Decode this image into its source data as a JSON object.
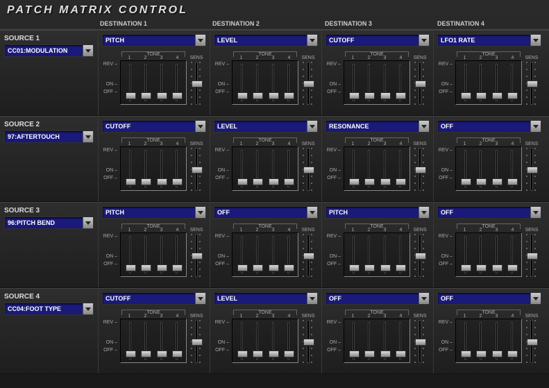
{
  "title": "PATCH MATRIX CONTROL",
  "dest_headers": [
    "DESTINATION 1",
    "DESTINATION 2",
    "DESTINATION 3",
    "DESTINATION 4"
  ],
  "tone_label": "TONE",
  "tone_nums": [
    "1",
    "2",
    "3",
    "4"
  ],
  "sens_label": "SENS",
  "sw": {
    "rev": "REV",
    "on": "ON",
    "off": "OFF"
  },
  "rows": [
    {
      "label": "SOURCE 1",
      "source": "CC01:MODULATION",
      "cells": [
        {
          "dest": "PITCH"
        },
        {
          "dest": "LEVEL"
        },
        {
          "dest": "CUTOFF"
        },
        {
          "dest": "LFO1 RATE"
        }
      ]
    },
    {
      "label": "SOURCE 2",
      "source": "97:AFTERTOUCH",
      "cells": [
        {
          "dest": "CUTOFF"
        },
        {
          "dest": "LEVEL"
        },
        {
          "dest": "RESONANCE"
        },
        {
          "dest": "OFF"
        }
      ]
    },
    {
      "label": "SOURCE 3",
      "source": "96:PITCH BEND",
      "cells": [
        {
          "dest": "PITCH"
        },
        {
          "dest": "OFF"
        },
        {
          "dest": "PITCH"
        },
        {
          "dest": "OFF"
        }
      ]
    },
    {
      "label": "SOURCE 4",
      "source": "CC04:FOOT TYPE",
      "cells": [
        {
          "dest": "CUTOFF"
        },
        {
          "dest": "LEVEL"
        },
        {
          "dest": "OFF"
        },
        {
          "dest": "OFF"
        }
      ]
    }
  ]
}
